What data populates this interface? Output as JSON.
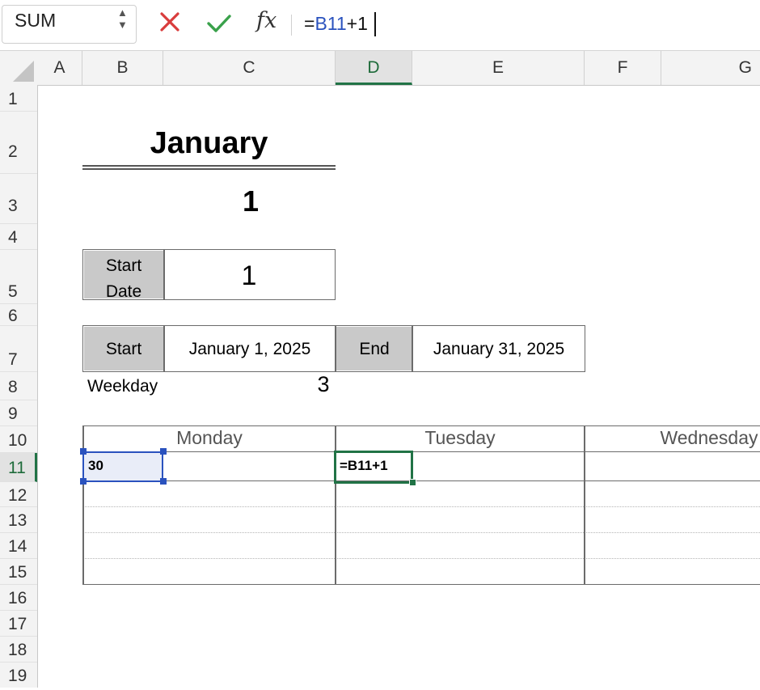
{
  "formula_bar": {
    "name_box": "SUM",
    "formula_prefix": "=",
    "formula_ref": "B11",
    "formula_suffix": "+1",
    "fx_label": "fx"
  },
  "columns": [
    "A",
    "B",
    "C",
    "D",
    "E",
    "F",
    "G"
  ],
  "selected_column": "D",
  "rows": [
    "1",
    "2",
    "3",
    "4",
    "5",
    "6",
    "7",
    "8",
    "9",
    "10",
    "11",
    "12",
    "13",
    "14",
    "15",
    "16",
    "17",
    "18",
    "19"
  ],
  "selected_row": "11",
  "sheet": {
    "month_title": "January",
    "big_number": "1",
    "start_date_label_line1": "Start",
    "start_date_label_line2": "Date",
    "start_date_value": "1",
    "start_label": "Start",
    "start_value": "January 1, 2025",
    "end_label": "End",
    "end_value": "January 31, 2025",
    "weekday_label": "Weekday",
    "weekday_value": "3",
    "day_headers": [
      "Monday",
      "Tuesday",
      "Wednesday"
    ],
    "b11_value": "30",
    "d11_value": "=B11+1"
  },
  "colors": {
    "ref_blue": "#2a52be",
    "active_green": "#217346",
    "cancel_red": "#d93c3c",
    "enter_green": "#3aa14b"
  }
}
